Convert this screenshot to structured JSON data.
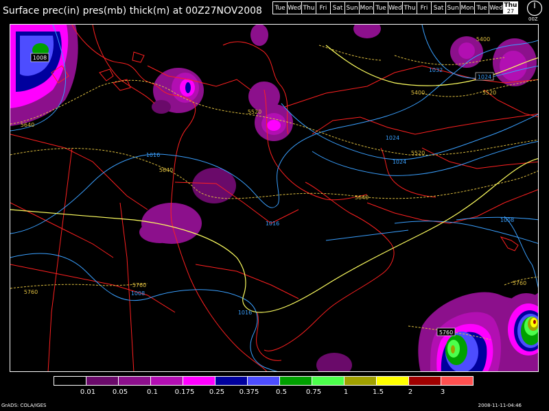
{
  "title": "Surface prec(in) pres(mb) thick(m) at 00Z27NOV2008",
  "days": [
    "Tue",
    "Wed",
    "Thu",
    "Fri",
    "Sat",
    "Sun",
    "Mon",
    "Tue",
    "Wed",
    "Thu",
    "Fri",
    "Sat",
    "Sun",
    "Mon",
    "Tue",
    "Wed"
  ],
  "active_day": {
    "name": "Thu",
    "date": "27"
  },
  "clock_label": "00Z",
  "legend": {
    "colors": [
      "#000000",
      "#6a0a6a",
      "#8c108c",
      "#b20fb2",
      "#ff00ff",
      "#00009e",
      "#4d4dff",
      "#00a000",
      "#4cff4c",
      "#a0a000",
      "#ffff00",
      "#a00000",
      "#ff5050"
    ],
    "labels": [
      "0.01",
      "0.05",
      "0.1",
      "0.175",
      "0.25",
      "0.375",
      "0.5",
      "0.75",
      "1",
      "1.5",
      "2",
      "3"
    ]
  },
  "pressure_labels": [
    "1008",
    "1016",
    "1016",
    "1016",
    "1024",
    "1024",
    "1032",
    "1008",
    "1008"
  ],
  "thickness_labels": [
    "5640",
    "5640",
    "5520",
    "5520",
    "5400",
    "5400",
    "5520",
    "5640",
    "5760",
    "5760",
    "5760",
    "5760"
  ],
  "footer_left": "GrADS: COLA/IGES",
  "footer_right": "2008-11-11-04:46"
}
